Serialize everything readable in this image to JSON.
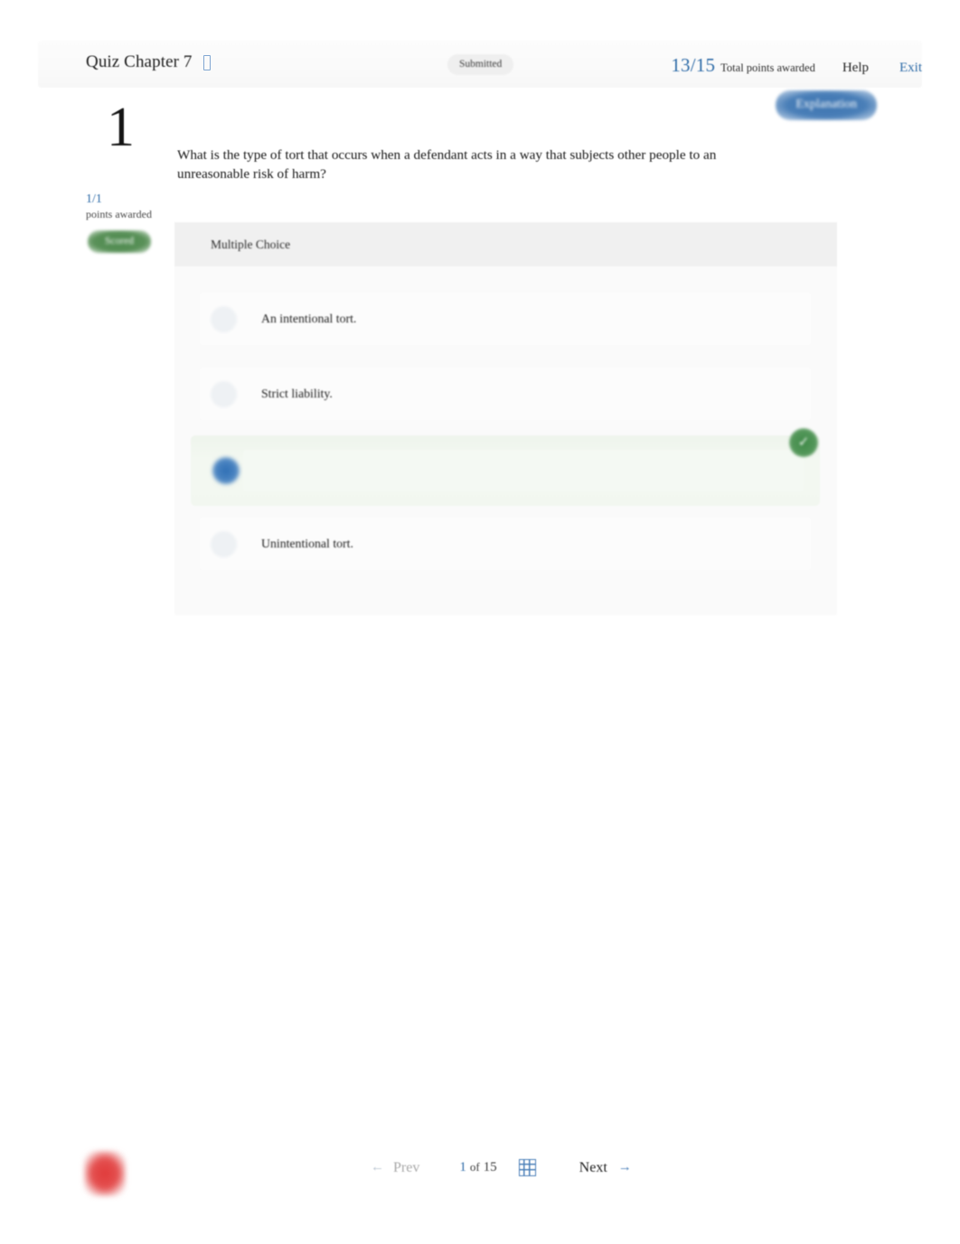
{
  "header": {
    "quiz_title": "Quiz Chapter 7",
    "title_icon": "placeholder-box-icon",
    "status_badge": "Submitted",
    "score_fraction": "13/15",
    "score_label": "Total points awarded",
    "help_label": "Help",
    "exit_label": "Exit",
    "explanation_label": "Explanation",
    "accent_blue": "#2f6ca8",
    "green": "#49874a"
  },
  "left_rail": {
    "question_number": "1",
    "points_fraction": "1/1",
    "points_label": "points awarded",
    "scored_badge": "Scored"
  },
  "question": {
    "text": "What is the type of tort that occurs when a defendant acts in a way that subjects other people to an unreasonable risk of harm?"
  },
  "choices_card": {
    "type_label": "Multiple Choice",
    "options": [
      {
        "label": "An intentional tort.",
        "selected": false,
        "correct": false
      },
      {
        "label": "Strict liability.",
        "selected": false,
        "correct": false
      },
      {
        "label": "",
        "selected": true,
        "correct": true
      },
      {
        "label": "Unintentional tort.",
        "selected": false,
        "correct": false
      }
    ],
    "correct_mark": "✓"
  },
  "bottom_nav": {
    "prev_arrow": "←",
    "prev_label": "Prev",
    "current_page": "1",
    "of_label": "of",
    "total_pages": "15",
    "grid_icon": "grid-navigator-icon",
    "next_label": "Next",
    "next_arrow": "→",
    "brand_mark": "red-rounded-square-logo"
  }
}
